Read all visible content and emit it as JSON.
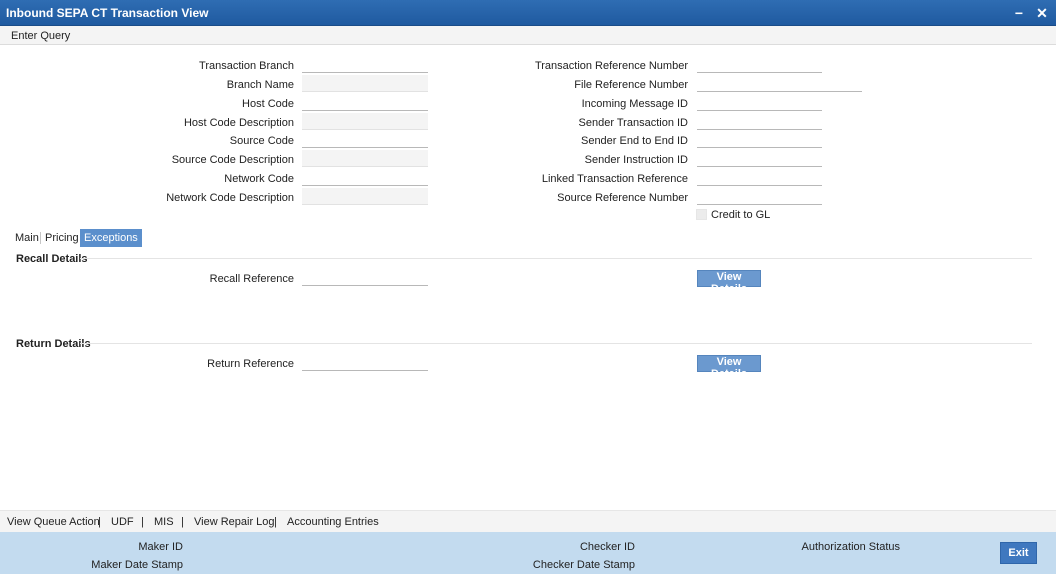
{
  "window": {
    "title": "Inbound SEPA CT Transaction View",
    "minimize_glyph": "−",
    "close_glyph": "✕"
  },
  "menu": {
    "enter_query": "Enter Query"
  },
  "left_fields": [
    {
      "label": "Transaction Branch",
      "value": ""
    },
    {
      "label": "Branch Name",
      "value": ""
    },
    {
      "label": "Host Code",
      "value": ""
    },
    {
      "label": "Host Code Description",
      "value": ""
    },
    {
      "label": "Source Code",
      "value": ""
    },
    {
      "label": "Source Code Description",
      "value": ""
    },
    {
      "label": "Network Code",
      "value": ""
    },
    {
      "label": "Network Code Description",
      "value": ""
    }
  ],
  "right_fields": [
    {
      "label": "Transaction Reference Number",
      "value": ""
    },
    {
      "label": "File Reference Number",
      "value": ""
    },
    {
      "label": "Incoming Message ID",
      "value": ""
    },
    {
      "label": "Sender Transaction ID",
      "value": ""
    },
    {
      "label": "Sender End to End ID",
      "value": ""
    },
    {
      "label": "Sender Instruction ID",
      "value": ""
    },
    {
      "label": "Linked Transaction Reference",
      "value": ""
    },
    {
      "label": "Source Reference Number",
      "value": ""
    }
  ],
  "credit_to_gl": {
    "label": "Credit to GL",
    "checked": false
  },
  "tabs": [
    "Main",
    "Pricing",
    "Exceptions"
  ],
  "active_tab": "Exceptions",
  "recall": {
    "section_title": "Recall Details",
    "reference_label": "Recall Reference",
    "reference_value": "",
    "button": "View Details"
  },
  "return": {
    "section_title": "Return Details",
    "reference_label": "Return Reference",
    "reference_value": "",
    "button": "View Details"
  },
  "actions": [
    "View Queue Action",
    "UDF",
    "MIS",
    "View Repair Log",
    "Accounting Entries"
  ],
  "footer": {
    "maker_id": "Maker ID",
    "maker_date_stamp": "Maker Date Stamp",
    "checker_id": "Checker ID",
    "checker_date_stamp": "Checker Date Stamp",
    "authorization_status": "Authorization Status",
    "exit": "Exit"
  },
  "colors": {
    "titlebar": "#1f5aa0",
    "active_tab": "#5b8fcc",
    "button": "#6b99cf",
    "footer": "#c3dbef"
  }
}
